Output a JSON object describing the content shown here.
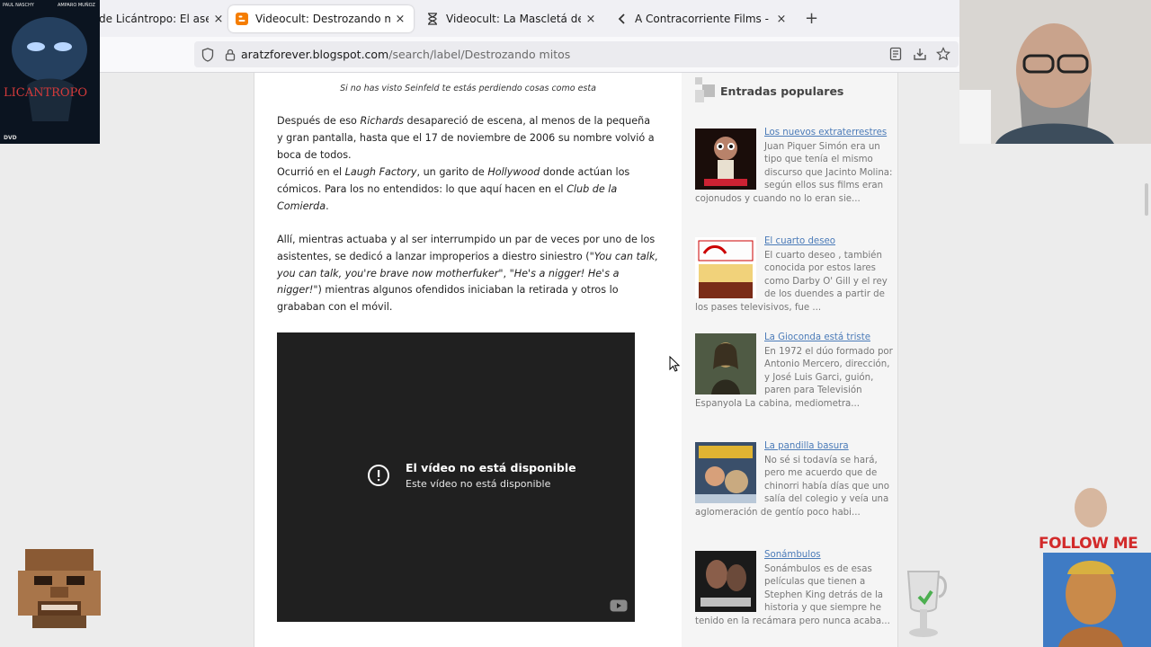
{
  "tabs": [
    {
      "title": "de Licántropo: El asesin",
      "active": false,
      "favicon": "blogger-icon"
    },
    {
      "title": "Videocult: Destrozando mitos",
      "active": true,
      "favicon": "blogger-icon"
    },
    {
      "title": "Videocult: La Mascletá de Pique",
      "active": false,
      "favicon": "hourglass-icon"
    },
    {
      "title": "A Contracorriente Films - Licánt",
      "active": false,
      "favicon": "back-arrow-icon"
    }
  ],
  "tab_close": "×",
  "new_tab": "+",
  "address": {
    "domain": "aratzforever.blogspot.com",
    "path": "/search/label/Destrozando mitos"
  },
  "post": {
    "caption": "Si no has visto Seinfeld te estás perdiendo cosas como esta",
    "p1_a": "Después de eso ",
    "p1_b": "Richards",
    "p1_c": " desapareció de escena, al menos de la pequeña y gran pantalla, hasta que el 17 de noviembre de 2006 su nombre volvió a boca de todos.",
    "p2_a": "Ocurrió en el ",
    "p2_b": "Laugh Factory",
    "p2_c": ", un garito de ",
    "p2_d": "Hollywood",
    "p2_e": " donde actúan los cómicos. Para los no entendidos: lo que aquí hacen en el ",
    "p2_f": "Club de la Comierda",
    "p2_g": ".",
    "p3_a": "Allí, mientras actuaba y al ser interrumpido un par de veces por uno de los asistentes, se dedicó a lanzar improperios a diestro siniestro (",
    "p3_b": "\"You can talk, you can talk, you're brave now motherfuker\"",
    "p3_c": ", ",
    "p3_d": "\"He's a nigger! He's a nigger!\"",
    "p3_e": ") mientras algunos ofendidos iniciaban la retirada y otros lo grababan con el móvil.",
    "video": {
      "title": "El vídeo no está disponible",
      "subtitle": "Este vídeo no está disponible"
    }
  },
  "sidebar": {
    "title": "Entradas populares",
    "items": [
      {
        "title": "Los nuevos extraterrestres",
        "text": "Juan Piquer Simón era un tipo que tenía el mismo discurso que Jacinto Molina: según ellos sus films eran cojonudos y cuando no lo eran sie..."
      },
      {
        "title": "El cuarto deseo",
        "text": "El cuarto deseo , también conocida por estos lares como Darby O' Gill y el rey de los duendes a partir de los pases televisivos, fue ..."
      },
      {
        "title": "La Gioconda está triste",
        "text": "  En 1972 el dúo formado por Antonio Mercero, dirección, y José Luis Garci, guión, paren para Televisión Espanyola La cabina, mediometra..."
      },
      {
        "title": "La pandilla basura",
        "text": "No sé si todavía se hará, pero me acuerdo que de chinorri había días que uno salía del colegio y veía una aglomeración de gentío poco habi..."
      },
      {
        "title": "Sonámbulos",
        "text": "Sonámbulos es de esas películas que tienen a Stephen King detrás de la historia y que siempre he tenido en la recámara pero nunca acaba..."
      }
    ]
  },
  "overlay": {
    "poster_title": "LICANTROPO",
    "poster_top_left": "PAUL NASCHY",
    "poster_top_right": "AMPARO MUÑOZ",
    "poster_dvd": "DVD",
    "follow": "FOLLOW ME"
  }
}
